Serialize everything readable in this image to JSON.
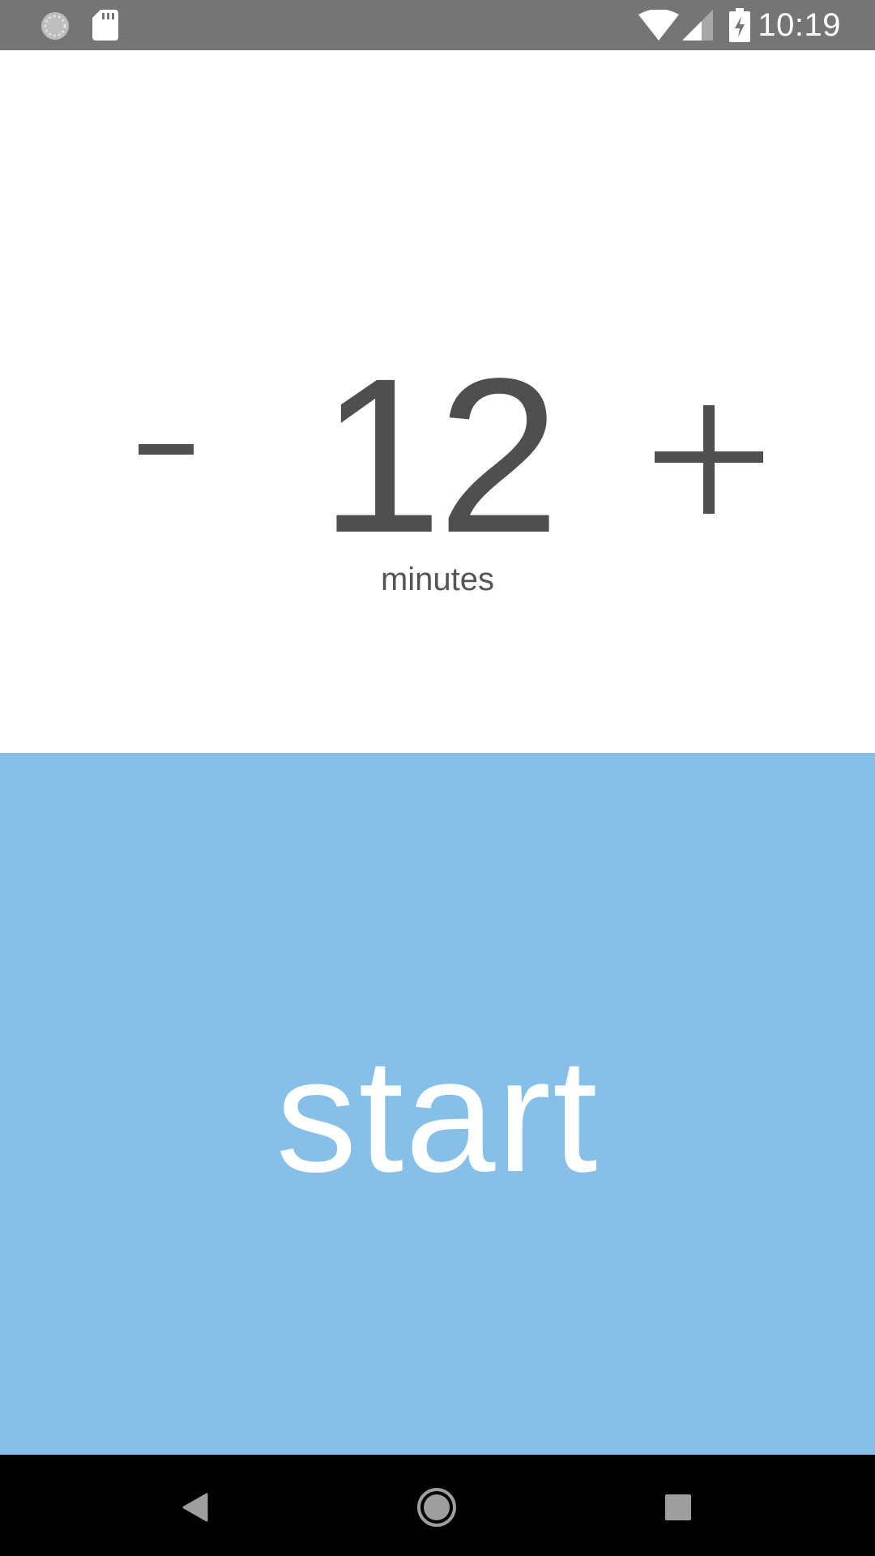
{
  "status_bar": {
    "time": "10:19",
    "icons": [
      "sync-icon",
      "sd-card-icon",
      "wifi-icon",
      "cell-signal-icon",
      "battery-charging-icon"
    ]
  },
  "timer": {
    "value": "12",
    "unit_label": "minutes",
    "decrement_label": "-",
    "increment_label": "+"
  },
  "start_button": {
    "label": "start",
    "color": "#86c0e8"
  },
  "nav_bar": {
    "icons": [
      "back-icon",
      "home-icon",
      "recents-icon"
    ]
  },
  "colors": {
    "status_bar": "#757575",
    "text_dark": "#4f4f4f",
    "accent": "#86c0e8",
    "nav_bar": "#000000"
  }
}
